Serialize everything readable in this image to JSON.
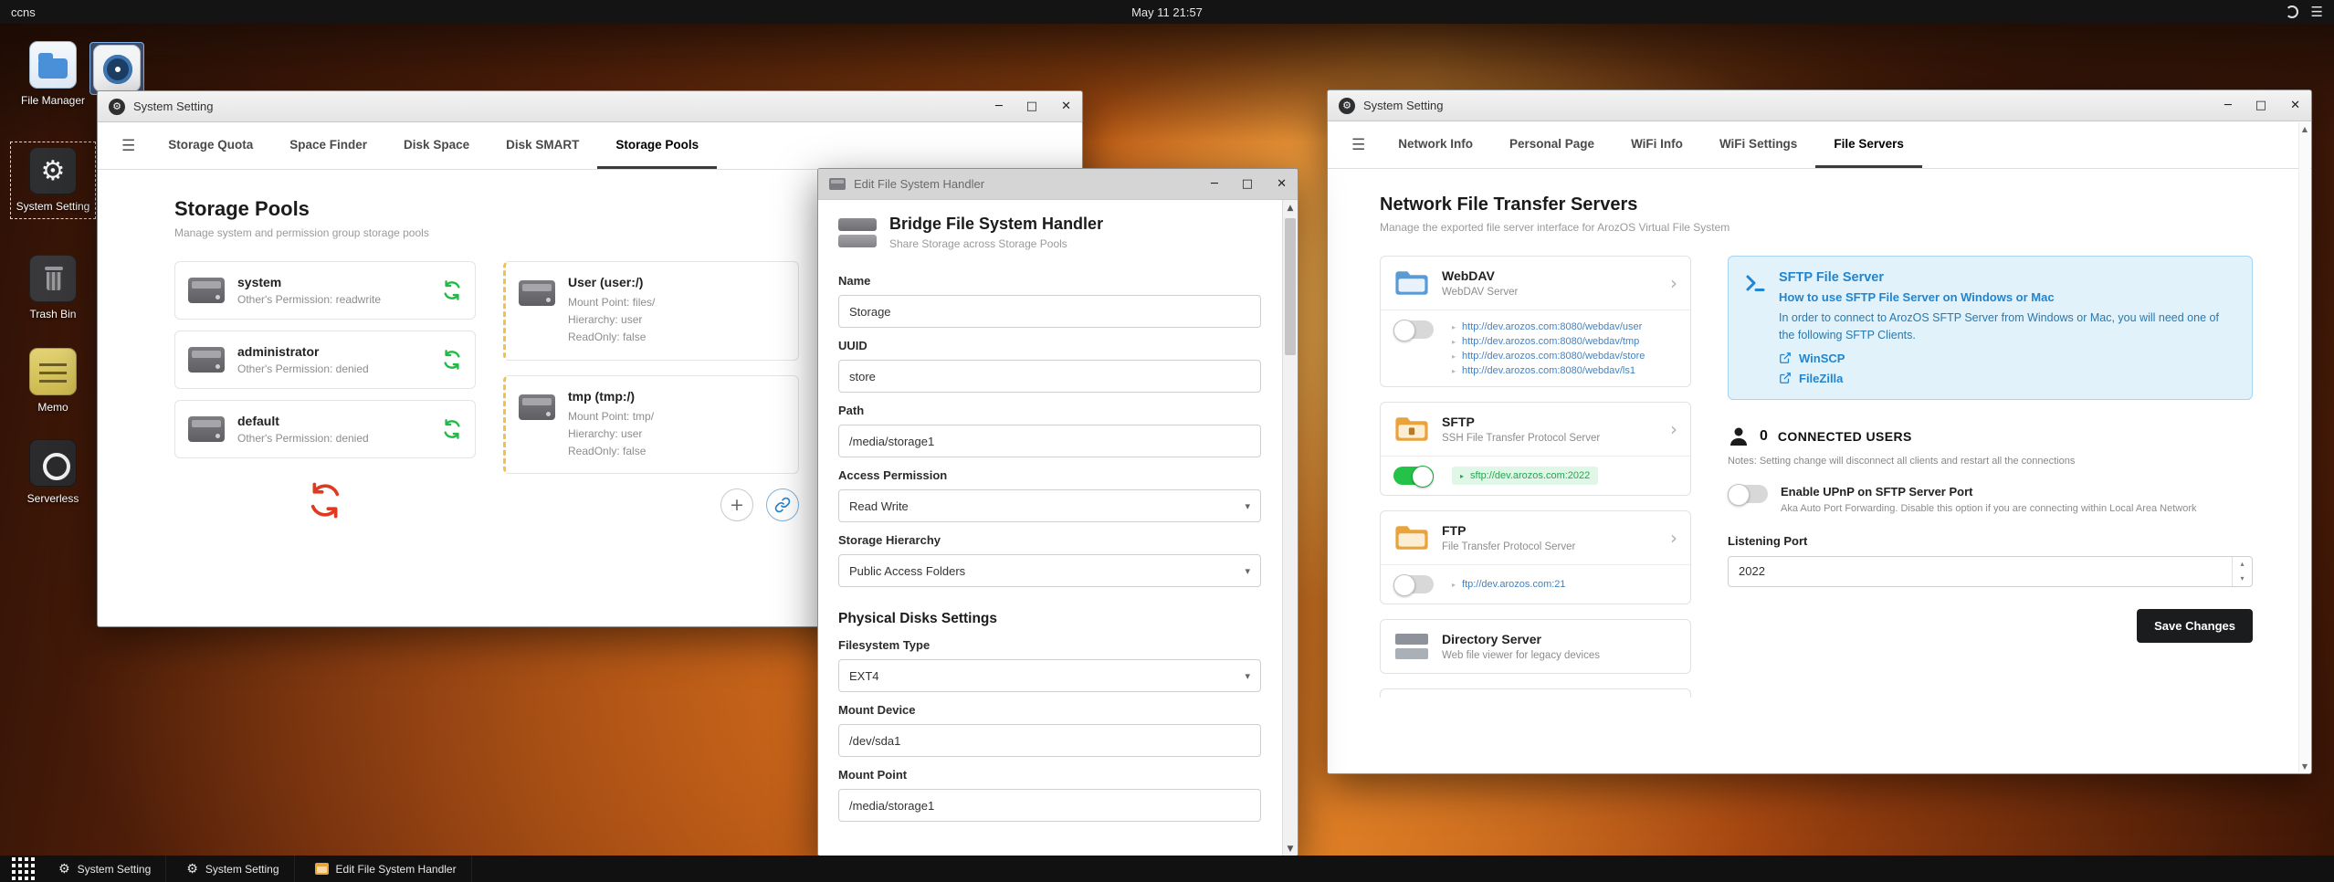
{
  "icons": {
    "gear": "⚙",
    "menu": "☰",
    "minimize": "─",
    "maximize": "□",
    "close": "✕",
    "caret_down": "▾",
    "chevron_right": "›",
    "bullet": "▸",
    "plus": "+",
    "arrow_up": "▲",
    "arrow_down": "▼",
    "spin_up": "▴",
    "spin_down": "▾"
  },
  "colors": {
    "accent_green": "#21ba45",
    "accent_blue": "#2185d0",
    "refresh_red": "#e03a1e",
    "dark_button": "#1b1c1d"
  },
  "topbar": {
    "host": "ccns",
    "clock": "May 11 21:57"
  },
  "desktop": {
    "icons": [
      {
        "label": "File Manager"
      },
      {
        "label": "System Setting"
      },
      {
        "label": "Trash Bin"
      },
      {
        "label": "Memo"
      },
      {
        "label": "Serverless"
      }
    ]
  },
  "window_storage": {
    "title": "System Setting",
    "tabs": [
      "Storage Quota",
      "Space Finder",
      "Disk Space",
      "Disk SMART",
      "Storage Pools"
    ],
    "heading": "Storage Pools",
    "subheading": "Manage system and permission group storage pools",
    "pools": [
      {
        "name": "system",
        "permission": "Other's Permission: readwrite"
      },
      {
        "name": "administrator",
        "permission": "Other's Permission: denied"
      },
      {
        "name": "default",
        "permission": "Other's Permission: denied"
      }
    ],
    "mounts": [
      {
        "name": "User (user:/)",
        "mount_point": "Mount Point: files/",
        "hierarchy": "Hierarchy: user",
        "readonly": "ReadOnly: false"
      },
      {
        "name": "tmp (tmp:/)",
        "mount_point": "Mount Point: tmp/",
        "hierarchy": "Hierarchy: user",
        "readonly": "ReadOnly: false"
      }
    ]
  },
  "window_editor": {
    "title": "Edit File System Handler",
    "heading": "Bridge File System Handler",
    "subheading": "Share Storage across Storage Pools",
    "fields": {
      "name_label": "Name",
      "name_value": "Storage",
      "uuid_label": "UUID",
      "uuid_value": "store",
      "path_label": "Path",
      "path_value": "/media/storage1",
      "access_label": "Access Permission",
      "access_value": "Read Write",
      "hierarchy_label": "Storage Hierarchy",
      "hierarchy_value": "Public Access Folders",
      "section_heading": "Physical Disks Settings",
      "fstype_label": "Filesystem Type",
      "fstype_value": "EXT4",
      "mount_device_label": "Mount Device",
      "mount_device_value": "/dev/sda1",
      "mount_point_label": "Mount Point",
      "mount_point_value": "/media/storage1"
    }
  },
  "window_network": {
    "title": "System Setting",
    "tabs": [
      "Network Info",
      "Personal Page",
      "WiFi Info",
      "WiFi Settings",
      "File Servers"
    ],
    "heading": "Network File Transfer Servers",
    "subheading": "Manage the exported file server interface for ArozOS Virtual File System",
    "servers": [
      {
        "name": "WebDAV",
        "desc": "WebDAV Server",
        "links": [
          "http://dev.arozos.com:8080/webdav/user",
          "http://dev.arozos.com:8080/webdav/tmp",
          "http://dev.arozos.com:8080/webdav/store",
          "http://dev.arozos.com:8080/webdav/ls1"
        ]
      },
      {
        "name": "SFTP",
        "desc": "SSH File Transfer Protocol Server",
        "links": [
          "sftp://dev.arozos.com:2022"
        ]
      },
      {
        "name": "FTP",
        "desc": "File Transfer Protocol Server",
        "links": [
          "ftp://dev.arozos.com:21"
        ]
      },
      {
        "name": "Directory Server",
        "desc": "Web file viewer for legacy devices",
        "links": []
      }
    ],
    "info_box": {
      "title": "SFTP File Server",
      "subtitle": "How to use SFTP File Server on Windows or Mac",
      "body": "In order to connect to ArozOS SFTP Server from Windows or Mac, you will need one of the following SFTP Clients.",
      "clients": [
        "WinSCP",
        "FileZilla"
      ]
    },
    "connected": {
      "count": "0",
      "label": "CONNECTED USERS",
      "note": "Notes: Setting change will disconnect all clients and restart all the connections",
      "upnp_label": "Enable UPnP on SFTP Server Port",
      "upnp_desc": "Aka Auto Port Forwarding. Disable this option if you are connecting within Local Area Network",
      "port_label": "Listening Port",
      "port_value": "2022",
      "save_label": "Save Changes"
    }
  },
  "taskbar": {
    "items": [
      {
        "label": "System Setting"
      },
      {
        "label": "System Setting"
      },
      {
        "label": "Edit File System Handler"
      }
    ]
  }
}
